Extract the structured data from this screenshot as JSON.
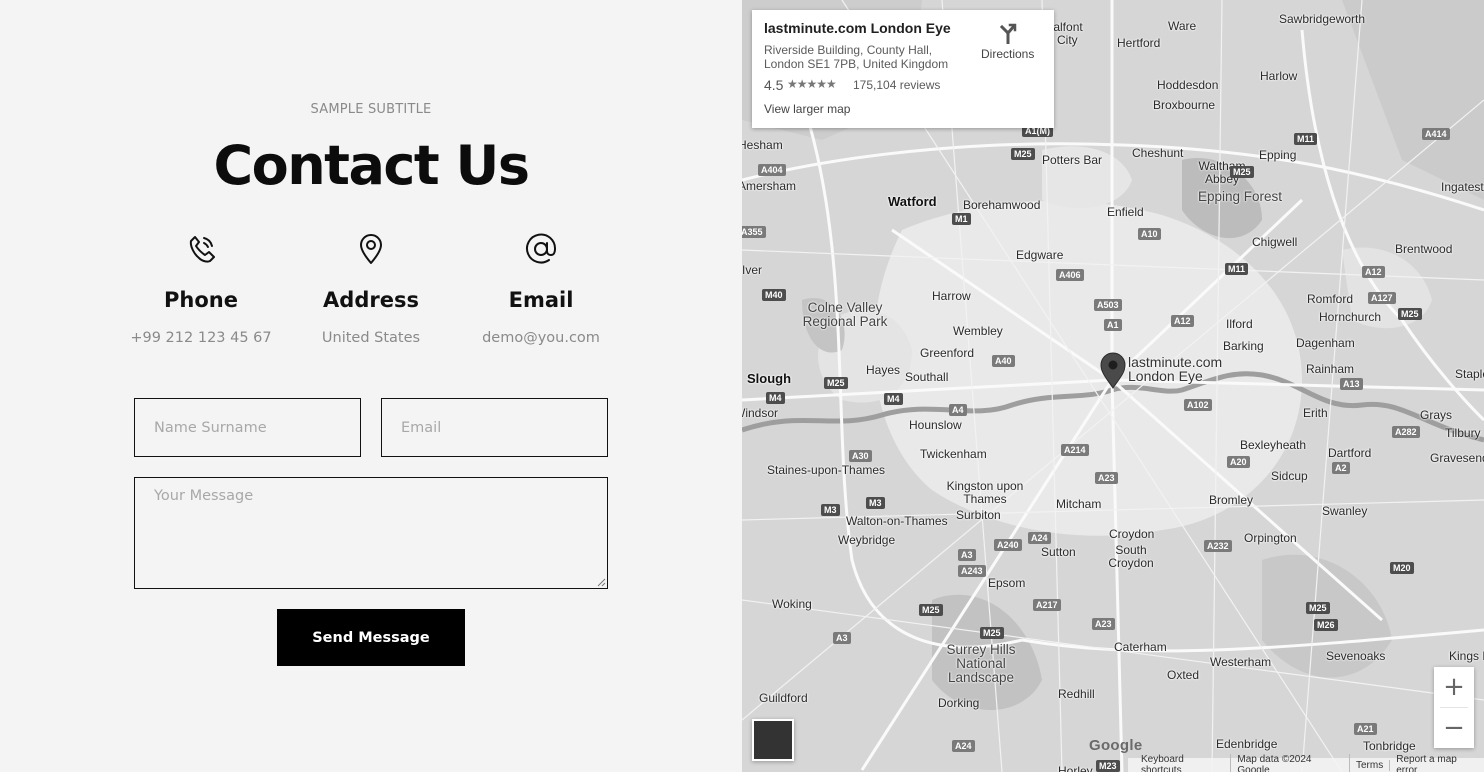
{
  "contact": {
    "subtitle": "SAMPLE SUBTITLE",
    "title": "Contact Us",
    "items": [
      {
        "icon": "phone-icon",
        "label": "Phone",
        "value": "+99 212 123 45 67"
      },
      {
        "icon": "location-pin-icon",
        "label": "Address",
        "value": "United States"
      },
      {
        "icon": "at-sign-icon",
        "label": "Email",
        "value": "demo@you.com"
      }
    ],
    "form": {
      "name_placeholder": "Name Surname",
      "email_placeholder": "Email",
      "message_placeholder": "Your Message",
      "send_label": "Send Message"
    }
  },
  "map": {
    "card": {
      "place_name": "lastminute.com London Eye",
      "address": "Riverside Building, County Hall, London SE1 7PB, United Kingdom",
      "rating": "4.5",
      "stars_icon": "star-rating-icon",
      "reviews": "175,104 reviews",
      "larger_map": "View larger map",
      "directions": "Directions"
    },
    "marker_label": "lastminute.com London Eye",
    "zoom_in": "+",
    "zoom_out": "−",
    "logo": "Google",
    "footer": {
      "shortcuts": "Keyboard shortcuts",
      "map_data": "Map data ©2024 Google",
      "terms": "Terms",
      "report": "Report a map error"
    },
    "places": [
      "Ware",
      "Sawbridgeworth",
      "Hertford",
      "Hoddesdon",
      "Harlow",
      "Broxbourne",
      "City",
      "Cheshunt",
      "Waltham Abbey",
      "Epping",
      "Potters Bar",
      "Watford",
      "Borehamwood",
      "Enfield",
      "Epping Forest",
      "Ingatestone",
      "Brentwood",
      "Chigwell",
      "Edgware",
      "Harrow",
      "Romford",
      "Hornchurch",
      "Colne Valley Regional Park",
      "Ilford",
      "Barking",
      "Dagenham",
      "Wembley",
      "Greenford",
      "Rainham",
      "Slough",
      "Hayes",
      "Southall",
      "Erith",
      "Grays",
      "Tilbury",
      "Windsor",
      "Hounslow",
      "Bexleyheath",
      "Dartford",
      "Gravesend",
      "Twickenham",
      "Sidcup",
      "Staines-upon-Thames",
      "Kingston upon Thames",
      "Bromley",
      "Swanley",
      "Surbiton",
      "Mitcham",
      "Walton-on-Thames",
      "Weybridge",
      "Croydon",
      "South Croydon",
      "Orpington",
      "Sutton",
      "Epsom",
      "Woking",
      "Surrey Hills National Landscape",
      "Caterham",
      "Westerham",
      "Sevenoaks",
      "Oxted",
      "Guildford",
      "Redhill",
      "Dorking",
      "Edenbridge",
      "Tonbridge",
      "Hesham",
      "Amersham",
      "Iver",
      "Chalfont",
      "Horley",
      "Kings Hill",
      "Stapleford"
    ],
    "roads": [
      "A1(M)",
      "M25",
      "M11",
      "A414",
      "M1",
      "A10",
      "M25",
      "A355",
      "A406",
      "A12",
      "M11",
      "A127",
      "M25",
      "M40",
      "A503",
      "A1",
      "A12",
      "A40",
      "M25",
      "A13",
      "M4",
      "M4",
      "A4",
      "A102",
      "A282",
      "A30",
      "A214",
      "A20",
      "A2",
      "A23",
      "M3",
      "M3",
      "A24",
      "A240",
      "A232",
      "A3",
      "A243",
      "M20",
      "M25",
      "A217",
      "A23",
      "M25",
      "M26",
      "A3",
      "M25",
      "A21",
      "M23",
      "A24",
      "A404"
    ]
  }
}
